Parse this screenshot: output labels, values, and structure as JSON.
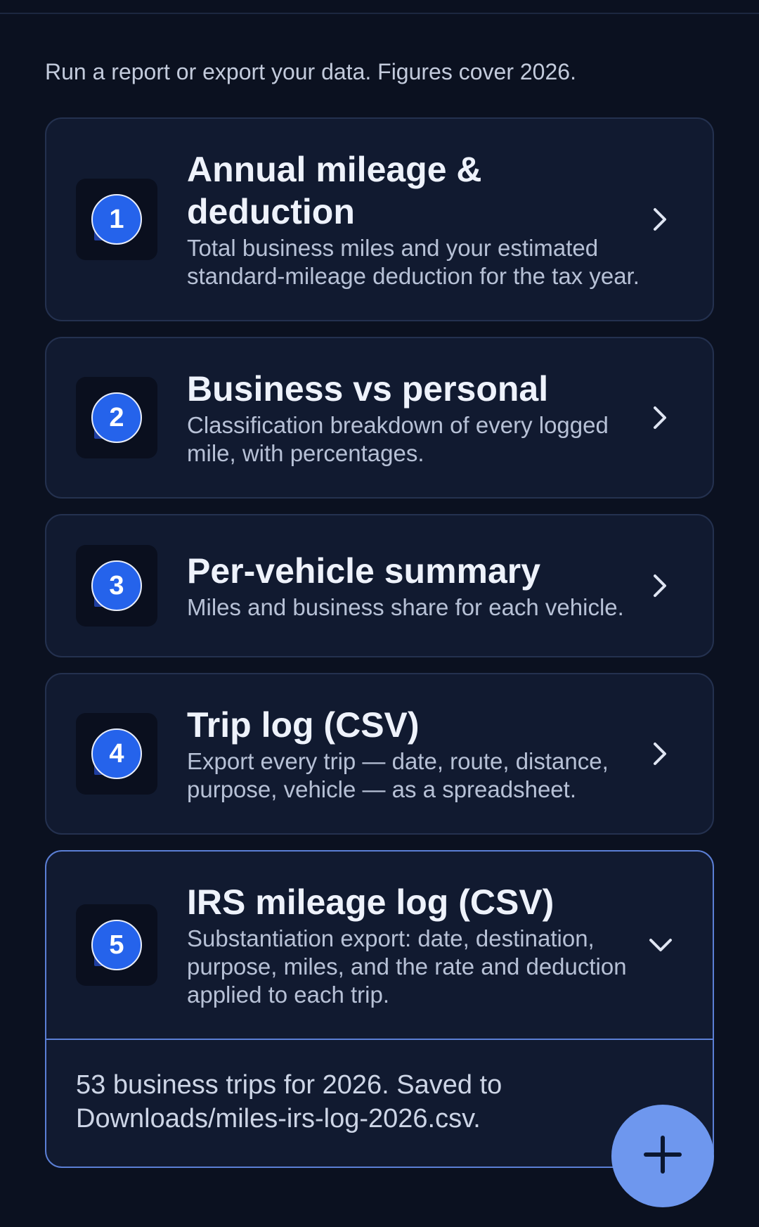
{
  "intro": "Run a report or export your data. Figures cover 2026.",
  "reports": [
    {
      "step": "1",
      "title": "Annual mileage & deduction",
      "description": "Total business miles and your estimated standard-mileage deduction for the tax year.",
      "chevron_icon": "chevron-right-icon"
    },
    {
      "step": "2",
      "title": "Business vs personal",
      "description": "Classification breakdown of every logged mile, with percentages.",
      "chevron_icon": "chevron-right-icon"
    },
    {
      "step": "3",
      "title": "Per-vehicle summary",
      "description": "Miles and business share for each vehicle.",
      "chevron_icon": "chevron-right-icon"
    },
    {
      "step": "4",
      "title": "Trip log (CSV)",
      "description": "Export every trip — date, route, distance, purpose, vehicle — as a spreadsheet.",
      "chevron_icon": "chevron-right-icon"
    },
    {
      "step": "5",
      "title": "IRS mileage log (CSV)",
      "description": "Substantiation export: date, destination, purpose, miles, and the rate and deduction applied to each trip.",
      "chevron_icon": "chevron-down-icon",
      "expanded": true,
      "result": "53 business trips for 2026. Saved to Downloads/miles-irs-log-2026.csv."
    }
  ],
  "fab": {
    "icon": "plus-icon"
  },
  "colors": {
    "background": "#0b1120",
    "card": "#111a30",
    "accent": "#2563eb",
    "fab": "#6e97ee"
  }
}
